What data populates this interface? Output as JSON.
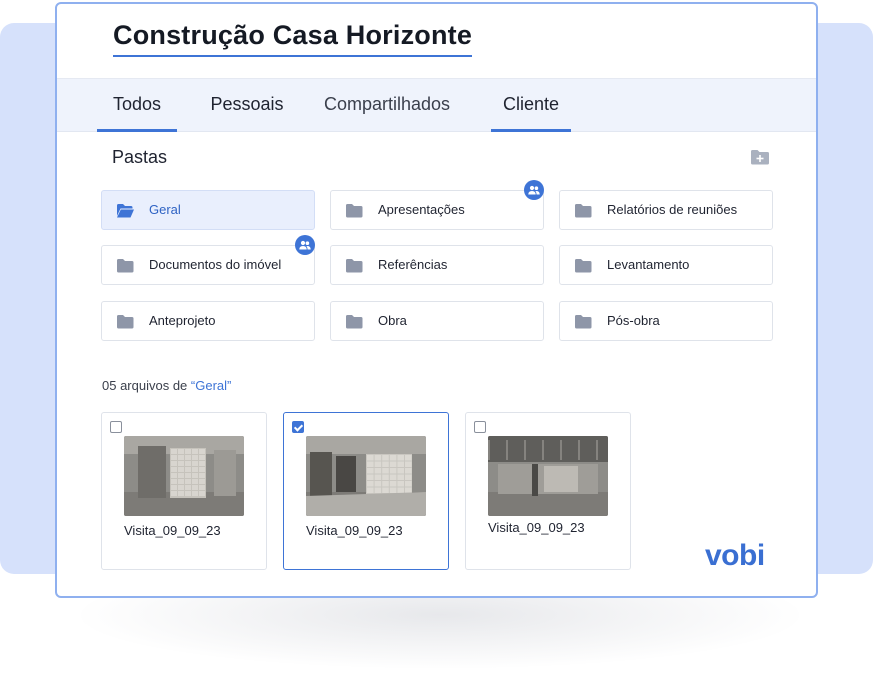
{
  "header": {
    "title": "Construção Casa Horizonte"
  },
  "tabs": [
    {
      "label": "Todos",
      "active": true
    },
    {
      "label": "Pessoais",
      "active": false
    },
    {
      "label": "Compartilhados",
      "active": false
    },
    {
      "label": "Cliente",
      "active": true
    }
  ],
  "folders_section": {
    "title": "Pastas",
    "new_folder_icon": "folder-plus-icon",
    "folders": [
      {
        "label": "Geral",
        "selected": true,
        "shared": false,
        "icon": "folder-open-icon"
      },
      {
        "label": "Apresentações",
        "selected": false,
        "shared": true,
        "icon": "folder-icon"
      },
      {
        "label": "Relatórios de reuniões",
        "selected": false,
        "shared": false,
        "icon": "folder-icon"
      },
      {
        "label": "Documentos do imóvel",
        "selected": false,
        "shared": true,
        "icon": "folder-icon"
      },
      {
        "label": "Referências",
        "selected": false,
        "shared": false,
        "icon": "folder-icon"
      },
      {
        "label": "Levantamento",
        "selected": false,
        "shared": false,
        "icon": "folder-icon"
      },
      {
        "label": "Anteprojeto",
        "selected": false,
        "shared": false,
        "icon": "folder-icon"
      },
      {
        "label": "Obra",
        "selected": false,
        "shared": false,
        "icon": "folder-icon"
      },
      {
        "label": "Pós-obra",
        "selected": false,
        "shared": false,
        "icon": "folder-icon"
      }
    ]
  },
  "files_section": {
    "count_prefix": "05 arquivos de ",
    "count_folder": "“Geral”",
    "files": [
      {
        "name": "Visita_09_09_23",
        "checked": false
      },
      {
        "name": "Visita_09_09_23",
        "checked": true
      },
      {
        "name": "Visita_09_09_23",
        "checked": false
      }
    ]
  },
  "brand": {
    "logo": "vobi"
  },
  "colors": {
    "accent": "#3e74d6",
    "backdrop": "#d6e1fb",
    "tab_bar": "#eff3fc",
    "folder_icon": "#8e96a8",
    "selected_folder_bg": "#e9effd"
  }
}
